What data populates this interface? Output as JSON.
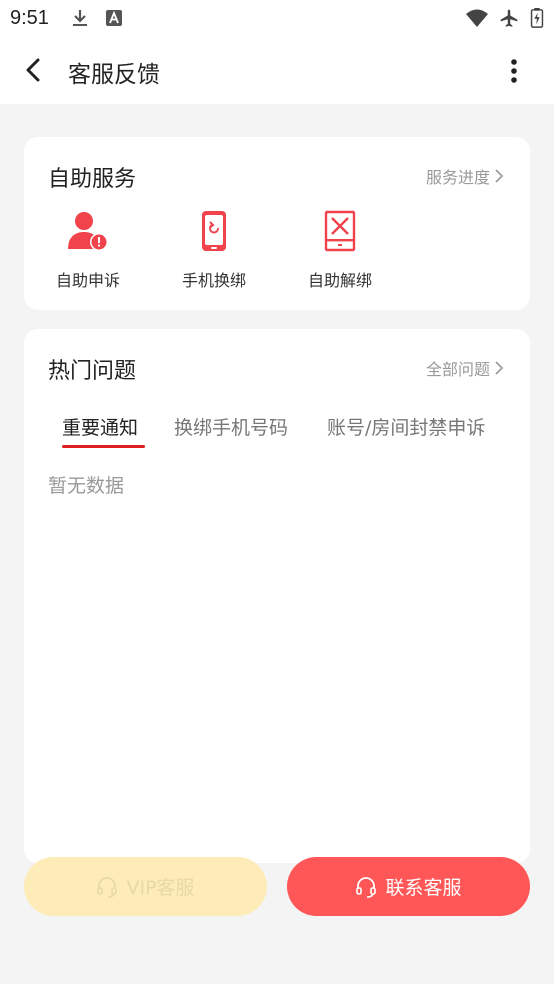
{
  "status": {
    "time": "9:51"
  },
  "header": {
    "title": "客服反馈"
  },
  "self_service": {
    "title": "自助服务",
    "progress_link": "服务进度",
    "items": [
      {
        "label": "自助申诉",
        "icon": "user-alert-icon"
      },
      {
        "label": "手机换绑",
        "icon": "phone-rebind-icon"
      },
      {
        "label": "自助解绑",
        "icon": "unbind-icon"
      }
    ]
  },
  "hot_questions": {
    "title": "热门问题",
    "all_link": "全部问题",
    "tabs": [
      "重要通知",
      "换绑手机号码",
      "账号/房间封禁申诉"
    ],
    "active_tab": 0,
    "empty_text": "暂无数据"
  },
  "actions": {
    "vip_label": "VIP客服",
    "contact_label": "联系客服"
  },
  "colors": {
    "accent_red": "#ff5757",
    "tab_underline": "#e02020",
    "vip_bg": "#fdebb8"
  }
}
